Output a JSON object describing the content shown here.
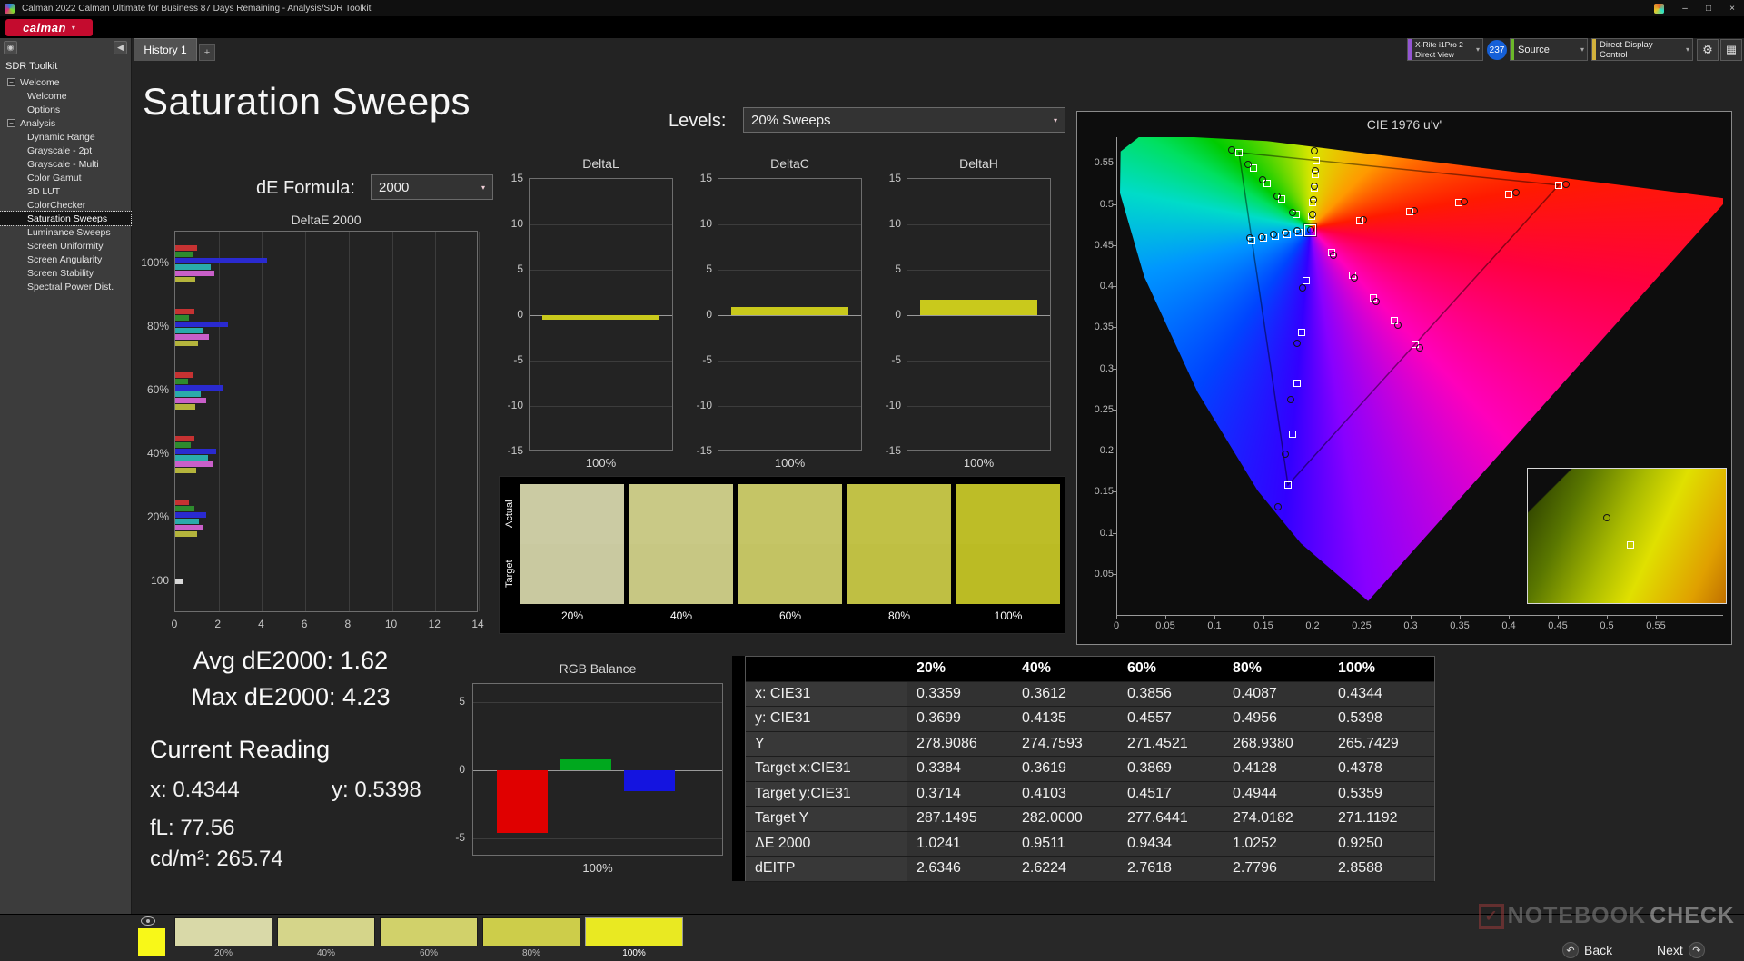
{
  "titlebar": {
    "title": "Calman 2022 Calman Ultimate for Business 87 Days Remaining  - Analysis/SDR Toolkit",
    "minimize": "–",
    "maximize": "□",
    "close": "×"
  },
  "menubar": {
    "logo_text": "calman"
  },
  "tabs": {
    "history": "History 1",
    "add": "+"
  },
  "meterbar": {
    "meter_line1": "X-Rite i1Pro 2",
    "meter_line2": "Direct View",
    "meter_badge": "237",
    "source": "Source",
    "display_control": "Direct Display Control"
  },
  "icons": {
    "gear": "⚙",
    "panel": "▦",
    "back_arrow": "↶",
    "next_arrow": "↷",
    "collapse": "◀",
    "target": "◉",
    "tree_expand": "−",
    "check": "✓"
  },
  "sidebar": {
    "toolkit": "SDR Toolkit",
    "selected": "Saturation Sweeps",
    "tree": [
      {
        "label": "Welcome",
        "children": [
          "Welcome",
          "Options"
        ]
      },
      {
        "label": "Analysis",
        "children": [
          "Dynamic Range",
          "Grayscale - 2pt",
          "Grayscale - Multi",
          "Color Gamut",
          "3D LUT",
          "ColorChecker",
          "Saturation Sweeps",
          "Luminance Sweeps",
          "Screen Uniformity",
          "Screen Angularity",
          "Screen Stability",
          "Spectral Power Dist."
        ]
      }
    ]
  },
  "page": {
    "title": "Saturation Sweeps",
    "levels_label": "Levels:",
    "levels_value": "20% Sweeps",
    "de_label": "dE Formula:",
    "de_value": "2000"
  },
  "readings": {
    "avg": "Avg dE2000: 1.62",
    "max": "Max dE2000: 4.23",
    "current": "Current Reading",
    "x": "x: 0.4344",
    "y": "y: 0.5398",
    "fl": "fL: 77.56",
    "cd": "cd/m²: 265.74"
  },
  "footer": {
    "back": "Back",
    "next": "Next"
  },
  "watermark": {
    "text1": "NOTEBOOK",
    "text2": "CHECK"
  },
  "chart_data": [
    {
      "id": "deltae2000",
      "type": "bar",
      "orientation": "horizontal",
      "title": "DeltaE 2000",
      "xlim": [
        0,
        14
      ],
      "xticks": [
        0,
        2,
        4,
        6,
        8,
        10,
        12,
        14
      ],
      "series_colors": {
        "red": "#c63232",
        "green": "#2e8b2e",
        "blue": "#2a2ad0",
        "cyan": "#2aabab",
        "magenta": "#c95fc9",
        "yellow": "#b4b43c",
        "white": "#d8d8d8"
      },
      "groups": [
        {
          "label": "100%",
          "bars": [
            [
              "red",
              1.0
            ],
            [
              "green",
              0.8
            ],
            [
              "blue",
              4.23
            ],
            [
              "cyan",
              1.62
            ],
            [
              "magenta",
              1.8
            ],
            [
              "yellow",
              0.93
            ]
          ]
        },
        {
          "label": "80%",
          "bars": [
            [
              "red",
              0.9
            ],
            [
              "green",
              0.62
            ],
            [
              "blue",
              2.45
            ],
            [
              "cyan",
              1.3
            ],
            [
              "magenta",
              1.55
            ],
            [
              "yellow",
              1.03
            ]
          ]
        },
        {
          "label": "60%",
          "bars": [
            [
              "red",
              0.8
            ],
            [
              "green",
              0.58
            ],
            [
              "blue",
              2.2
            ],
            [
              "cyan",
              1.18
            ],
            [
              "magenta",
              1.42
            ],
            [
              "yellow",
              0.94
            ]
          ]
        },
        {
          "label": "40%",
          "bars": [
            [
              "red",
              0.86
            ],
            [
              "green",
              0.7
            ],
            [
              "blue",
              1.9
            ],
            [
              "cyan",
              1.5
            ],
            [
              "magenta",
              1.78
            ],
            [
              "yellow",
              0.95
            ]
          ]
        },
        {
          "label": "20%",
          "bars": [
            [
              "red",
              0.62
            ],
            [
              "green",
              0.88
            ],
            [
              "blue",
              1.42
            ],
            [
              "cyan",
              1.1
            ],
            [
              "magenta",
              1.3
            ],
            [
              "yellow",
              1.02
            ]
          ]
        },
        {
          "label": "100",
          "bars": [
            [
              "white",
              0.38
            ]
          ]
        }
      ]
    },
    {
      "id": "deltaL",
      "type": "bar",
      "title": "DeltaL",
      "ylim": [
        -15,
        15
      ],
      "yticks": [
        15,
        10,
        5,
        0,
        -5,
        -10,
        -15
      ],
      "categories": [
        "100%"
      ],
      "values": [
        -0.5
      ],
      "bar_color": "#c9c91c"
    },
    {
      "id": "deltaC",
      "type": "bar",
      "title": "DeltaC",
      "ylim": [
        -15,
        15
      ],
      "yticks": [
        15,
        10,
        5,
        0,
        -5,
        -10,
        -15
      ],
      "categories": [
        "100%"
      ],
      "values": [
        0.9
      ],
      "bar_color": "#c9c91c"
    },
    {
      "id": "deltaH",
      "type": "bar",
      "title": "DeltaH",
      "ylim": [
        -15,
        15
      ],
      "yticks": [
        15,
        10,
        5,
        0,
        -5,
        -10,
        -15
      ],
      "categories": [
        "100%"
      ],
      "values": [
        1.7
      ],
      "bar_color": "#c9c91c"
    },
    {
      "id": "swatch-compare",
      "type": "swatches",
      "row_labels": [
        "Actual",
        "Target"
      ],
      "levels": [
        "20%",
        "40%",
        "60%",
        "80%",
        "100%"
      ],
      "actual_colors": [
        "#cbcba3",
        "#c9c986",
        "#c5c566",
        "#c1c146",
        "#bdbd27"
      ],
      "target_colors": [
        "#c9c9a0",
        "#c7c783",
        "#c3c363",
        "#bfbf43",
        "#bbbb24"
      ]
    },
    {
      "id": "cie1976",
      "type": "scatter",
      "title": "CIE 1976 u'v'",
      "xticks": [
        0,
        0.05,
        0.1,
        0.15,
        0.2,
        0.25,
        0.3,
        0.35,
        0.4,
        0.45,
        0.5,
        0.55
      ],
      "yticks": [
        0,
        0.05,
        0.1,
        0.15,
        0.2,
        0.25,
        0.3,
        0.35,
        0.4,
        0.45,
        0.5,
        0.55
      ],
      "white_point": [
        0.1978,
        0.4683
      ],
      "sweeps": [
        {
          "name": "red",
          "targets": [
            [
              0.2484,
              0.4792
            ],
            [
              0.299,
              0.4901
            ],
            [
              0.3495,
              0.5011
            ],
            [
              0.4001,
              0.512
            ],
            [
              0.4507,
              0.5229
            ]
          ],
          "measured": [
            [
              0.252,
              0.481
            ],
            [
              0.304,
              0.492
            ],
            [
              0.355,
              0.503
            ],
            [
              0.407,
              0.514
            ],
            [
              0.458,
              0.524
            ]
          ]
        },
        {
          "name": "green",
          "targets": [
            [
              0.1832,
              0.4871
            ],
            [
              0.1687,
              0.506
            ],
            [
              0.1541,
              0.5248
            ],
            [
              0.1396,
              0.5437
            ],
            [
              0.125,
              0.5625
            ]
          ],
          "measured": [
            [
              0.18,
              0.49
            ],
            [
              0.164,
              0.509
            ],
            [
              0.149,
              0.529
            ],
            [
              0.134,
              0.548
            ],
            [
              0.118,
              0.566
            ]
          ]
        },
        {
          "name": "blue",
          "targets": [
            [
              0.1933,
              0.4062
            ],
            [
              0.1888,
              0.3441
            ],
            [
              0.1844,
              0.2821
            ],
            [
              0.1799,
              0.22
            ],
            [
              0.1754,
              0.1579
            ]
          ],
          "measured": [
            [
              0.19,
              0.398
            ],
            [
              0.184,
              0.33
            ],
            [
              0.178,
              0.262
            ],
            [
              0.172,
              0.196
            ],
            [
              0.165,
              0.132
            ]
          ]
        },
        {
          "name": "cyan",
          "targets": [
            [
              0.1859,
              0.4657
            ],
            [
              0.174,
              0.4631
            ],
            [
              0.1621,
              0.4606
            ],
            [
              0.1502,
              0.458
            ],
            [
              0.1383,
              0.4554
            ]
          ],
          "measured": [
            [
              0.184,
              0.467
            ],
            [
              0.172,
              0.465
            ],
            [
              0.16,
              0.463
            ],
            [
              0.148,
              0.46
            ],
            [
              0.136,
              0.458
            ]
          ]
        },
        {
          "name": "magenta",
          "targets": [
            [
              0.2192,
              0.4406
            ],
            [
              0.2407,
              0.4129
            ],
            [
              0.2621,
              0.3852
            ],
            [
              0.2836,
              0.3575
            ],
            [
              0.305,
              0.3298
            ]
          ],
          "measured": [
            [
              0.221,
              0.438
            ],
            [
              0.243,
              0.41
            ],
            [
              0.265,
              0.381
            ],
            [
              0.287,
              0.353
            ],
            [
              0.309,
              0.325
            ]
          ]
        },
        {
          "name": "yellow",
          "targets": [
            [
              0.199,
              0.4852
            ],
            [
              0.2002,
              0.5021
            ],
            [
              0.2015,
              0.5191
            ],
            [
              0.2027,
              0.536
            ],
            [
              0.2039,
              0.5529
            ]
          ],
          "measured": [
            [
              0.2,
              0.487
            ],
            [
              0.201,
              0.505
            ],
            [
              0.202,
              0.522
            ],
            [
              0.203,
              0.54
            ],
            [
              0.2018,
              0.5643
            ]
          ]
        }
      ]
    },
    {
      "id": "rgb-balance",
      "type": "bar",
      "title": "RGB Balance",
      "ylim": [
        -6.3,
        6.3
      ],
      "yticks": [
        5,
        0,
        -5
      ],
      "categories": [
        "100%"
      ],
      "series": [
        {
          "name": "red",
          "color": "#e00000",
          "value": -4.6
        },
        {
          "name": "green",
          "color": "#00a81e",
          "value": 0.8
        },
        {
          "name": "blue",
          "color": "#1414e0",
          "value": -1.5
        }
      ]
    },
    {
      "id": "results-table",
      "type": "table",
      "columns": [
        "",
        "20%",
        "40%",
        "60%",
        "80%",
        "100%"
      ],
      "rows": [
        [
          "x: CIE31",
          "0.3359",
          "0.3612",
          "0.3856",
          "0.4087",
          "0.4344"
        ],
        [
          "y: CIE31",
          "0.3699",
          "0.4135",
          "0.4557",
          "0.4956",
          "0.5398"
        ],
        [
          "Y",
          "278.9086",
          "274.7593",
          "271.4521",
          "268.9380",
          "265.7429"
        ],
        [
          "Target x:CIE31",
          "0.3384",
          "0.3619",
          "0.3869",
          "0.4128",
          "0.4378"
        ],
        [
          "Target y:CIE31",
          "0.3714",
          "0.4103",
          "0.4517",
          "0.4944",
          "0.5359"
        ],
        [
          "Target Y",
          "287.1495",
          "282.0000",
          "277.6441",
          "274.0182",
          "271.1192"
        ],
        [
          "ΔE 2000",
          "1.0241",
          "0.9511",
          "0.9434",
          "1.0252",
          "0.9250"
        ],
        [
          "dEITP",
          "2.6346",
          "2.6224",
          "2.7618",
          "2.7796",
          "2.8588"
        ]
      ]
    },
    {
      "id": "filmstrip",
      "type": "swatches",
      "tiles": [
        {
          "label": "",
          "color": "#f8f818",
          "selected": false
        },
        {
          "label": "20%",
          "color": "#d9d9a8",
          "selected": false
        },
        {
          "label": "40%",
          "color": "#d5d58a",
          "selected": false
        },
        {
          "label": "60%",
          "color": "#d1d16a",
          "selected": false
        },
        {
          "label": "80%",
          "color": "#cdcd4a",
          "selected": false
        },
        {
          "label": "100%",
          "color": "#e9e922",
          "selected": true
        }
      ]
    }
  ]
}
